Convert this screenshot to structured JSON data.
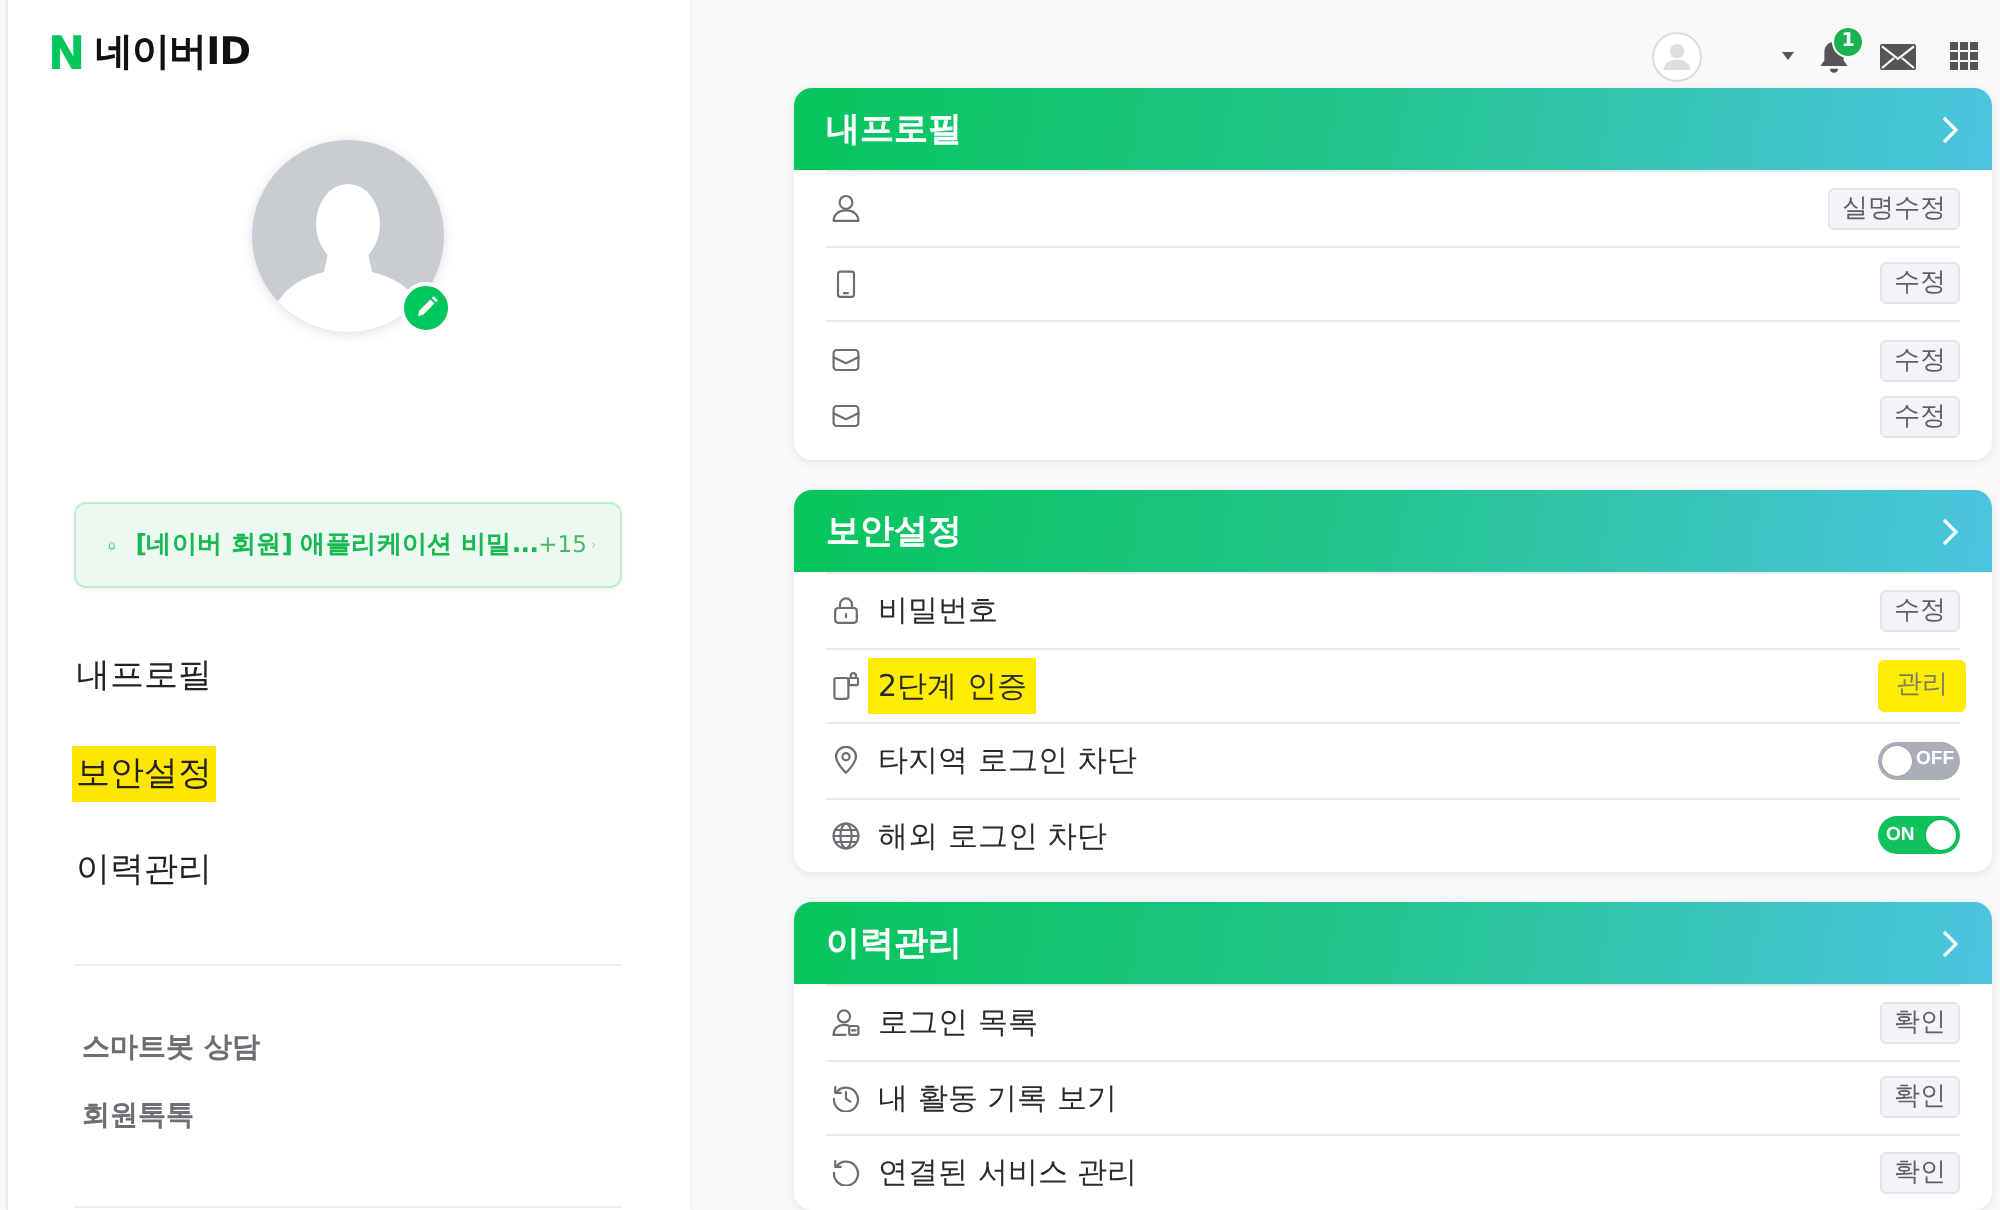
{
  "sidebar": {
    "logo_mark": "N",
    "logo_text": "네이버ID",
    "notice": {
      "text": "[네이버 회원] 애플리케이션 비밀...",
      "count": "+15"
    },
    "menu": [
      {
        "label": "내프로필",
        "highlighted": false
      },
      {
        "label": "보안설정",
        "highlighted": true
      },
      {
        "label": "이력관리",
        "highlighted": false
      }
    ],
    "links": [
      {
        "label": "스마트봇 상담"
      },
      {
        "label": "회원톡톡"
      }
    ]
  },
  "header": {
    "notification_count": "1"
  },
  "cards": [
    {
      "title": "내프로필",
      "rows": [
        {
          "lines": [
            {
              "control": {
                "kind": "button",
                "text": "실명수정",
                "highlighted": false
              }
            }
          ]
        },
        {
          "lines": [
            {
              "control": {
                "kind": "button",
                "text": "수정",
                "highlighted": false
              }
            }
          ]
        },
        {
          "lines": [
            {
              "control": {
                "kind": "button",
                "text": "수정",
                "highlighted": false
              }
            },
            {
              "control": {
                "kind": "button",
                "text": "수정",
                "highlighted": false
              }
            }
          ]
        }
      ]
    },
    {
      "title": "보안설정",
      "rows": [
        {
          "lines": [
            {
              "label": "비밀번호",
              "highlighted": false,
              "control": {
                "kind": "button",
                "text": "수정",
                "highlighted": false
              }
            }
          ]
        },
        {
          "lines": [
            {
              "label": "2단계 인증",
              "highlighted": true,
              "control": {
                "kind": "button",
                "text": "관리",
                "highlighted": true
              }
            }
          ]
        },
        {
          "lines": [
            {
              "label": "타지역 로그인 차단",
              "highlighted": false,
              "control": {
                "kind": "toggle",
                "text": "OFF",
                "on": false
              }
            }
          ]
        },
        {
          "lines": [
            {
              "label": "해외 로그인 차단",
              "highlighted": false,
              "control": {
                "kind": "toggle",
                "text": "ON",
                "on": true
              }
            }
          ]
        }
      ]
    },
    {
      "title": "이력관리",
      "rows": [
        {
          "lines": [
            {
              "label": "로그인 목록",
              "highlighted": false,
              "control": {
                "kind": "button",
                "text": "확인",
                "highlighted": false
              }
            }
          ]
        },
        {
          "lines": [
            {
              "label": "내 활동 기록 보기",
              "highlighted": false,
              "control": {
                "kind": "button",
                "text": "확인",
                "highlighted": false
              }
            }
          ]
        },
        {
          "lines": [
            {
              "label": "연결된 서비스 관리",
              "highlighted": false,
              "control": {
                "kind": "button",
                "text": "확인",
                "highlighted": false
              }
            }
          ]
        }
      ]
    }
  ]
}
